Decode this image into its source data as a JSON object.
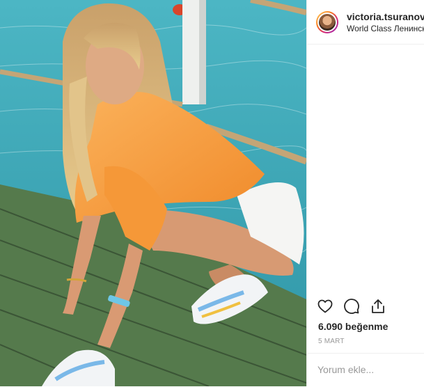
{
  "post": {
    "username": "victoria.tsuranova",
    "location": "World Class Ленински",
    "likes_text": "6.090 beğenme",
    "date_text": "5 MART",
    "comment_placeholder": "Yorum ekle..."
  },
  "icons": {
    "like": "heart-icon",
    "comment": "comment-bubble-icon",
    "share": "share-icon"
  },
  "colors": {
    "text": "#262626",
    "muted": "#999999",
    "divider": "#efefef",
    "sea": "#3fa9b8",
    "dock": "#4f6b47",
    "shirt": "#f79a3b"
  }
}
